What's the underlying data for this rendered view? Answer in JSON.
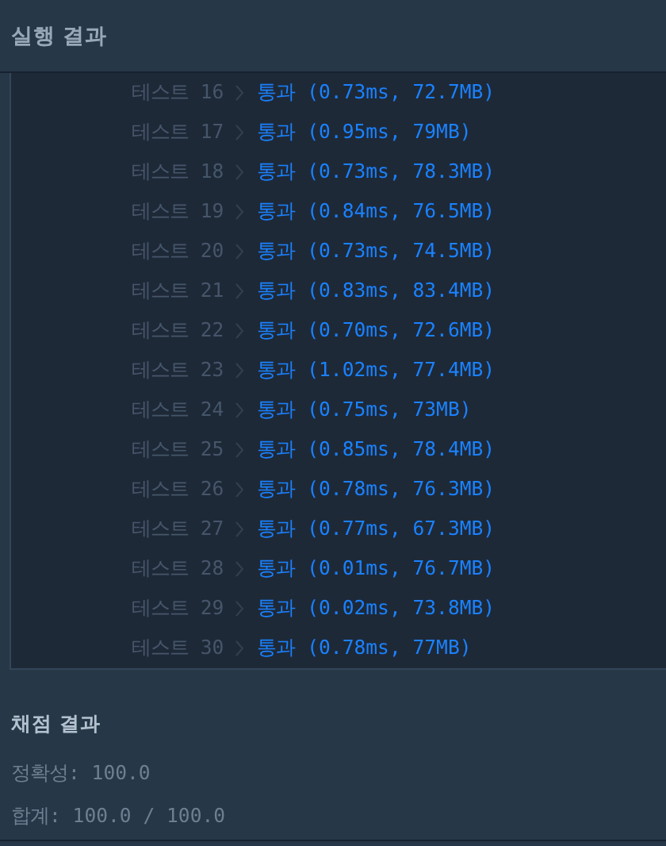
{
  "header": {
    "title": "실행 결과"
  },
  "tests": [
    {
      "label": "테스트 16",
      "passed": true,
      "result": "통과 (0.73ms, 72.7MB)"
    },
    {
      "label": "테스트 17",
      "passed": true,
      "result": "통과 (0.95ms, 79MB)"
    },
    {
      "label": "테스트 18",
      "passed": true,
      "result": "통과 (0.73ms, 78.3MB)"
    },
    {
      "label": "테스트 19",
      "passed": true,
      "result": "통과 (0.84ms, 76.5MB)"
    },
    {
      "label": "테스트 20",
      "passed": true,
      "result": "통과 (0.73ms, 74.5MB)"
    },
    {
      "label": "테스트 21",
      "passed": true,
      "result": "통과 (0.83ms, 83.4MB)"
    },
    {
      "label": "테스트 22",
      "passed": true,
      "result": "통과 (0.70ms, 72.6MB)"
    },
    {
      "label": "테스트 23",
      "passed": true,
      "result": "통과 (1.02ms, 77.4MB)"
    },
    {
      "label": "테스트 24",
      "passed": true,
      "result": "통과 (0.75ms, 73MB)"
    },
    {
      "label": "테스트 25",
      "passed": true,
      "result": "통과 (0.85ms, 78.4MB)"
    },
    {
      "label": "테스트 26",
      "passed": true,
      "result": "통과 (0.78ms, 76.3MB)"
    },
    {
      "label": "테스트 27",
      "passed": true,
      "result": "통과 (0.77ms, 67.3MB)"
    },
    {
      "label": "테스트 28",
      "passed": true,
      "result": "통과 (0.01ms, 76.7MB)"
    },
    {
      "label": "테스트 29",
      "passed": true,
      "result": "통과 (0.02ms, 73.8MB)"
    },
    {
      "label": "테스트 30",
      "passed": true,
      "result": "통과 (0.78ms, 77MB)"
    }
  ],
  "grading": {
    "title": "채점 결과",
    "lines": [
      "정확성: 100.0",
      "합계: 100.0 / 100.0"
    ]
  }
}
